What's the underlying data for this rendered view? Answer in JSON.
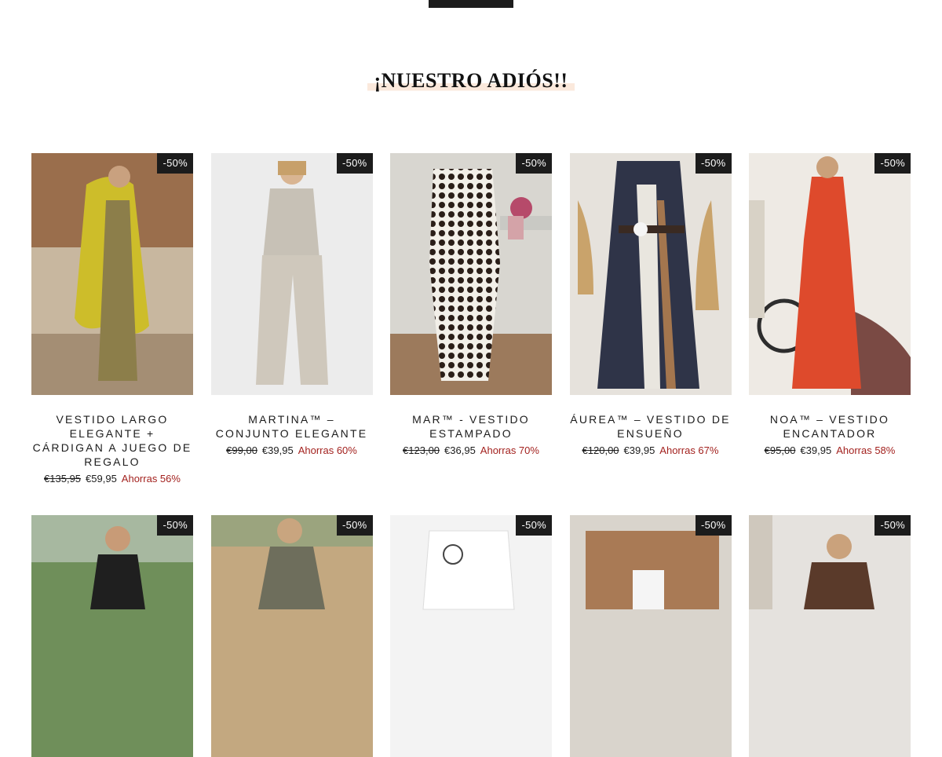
{
  "section": {
    "title": "¡NUESTRO ADIÓS!!"
  },
  "products_row1": [
    {
      "name": "VESTIDO LARGO ELEGANTE + CÁRDIGAN A JUEGO DE REGALO",
      "badge": "-50%",
      "old_price": "€135,95",
      "price": "€59,95",
      "savings": "Ahorras 56%"
    },
    {
      "name": "MARTINA™ – CONJUNTO ELEGANTE",
      "badge": "-50%",
      "old_price": "€99,00",
      "price": "€39,95",
      "savings": "Ahorras 60%"
    },
    {
      "name": "MAR™ - VESTIDO ESTAMPADO",
      "badge": "-50%",
      "old_price": "€123,00",
      "price": "€36,95",
      "savings": "Ahorras 70%"
    },
    {
      "name": "ÁUREA™ – VESTIDO DE ENSUEÑO",
      "badge": "-50%",
      "old_price": "€120,00",
      "price": "€39,95",
      "savings": "Ahorras 67%"
    },
    {
      "name": "NOA™ – VESTIDO ENCANTADOR",
      "badge": "-50%",
      "old_price": "€95,00",
      "price": "€39,95",
      "savings": "Ahorras 58%"
    }
  ],
  "products_row2": [
    {
      "badge": "-50%"
    },
    {
      "badge": "-50%"
    },
    {
      "badge": "-50%"
    },
    {
      "badge": "-50%"
    },
    {
      "badge": "-50%"
    }
  ],
  "colors": {
    "badge_bg": "#1c1c1c",
    "savings": "#a3221f",
    "title_highlight": "#fbe9dc"
  }
}
